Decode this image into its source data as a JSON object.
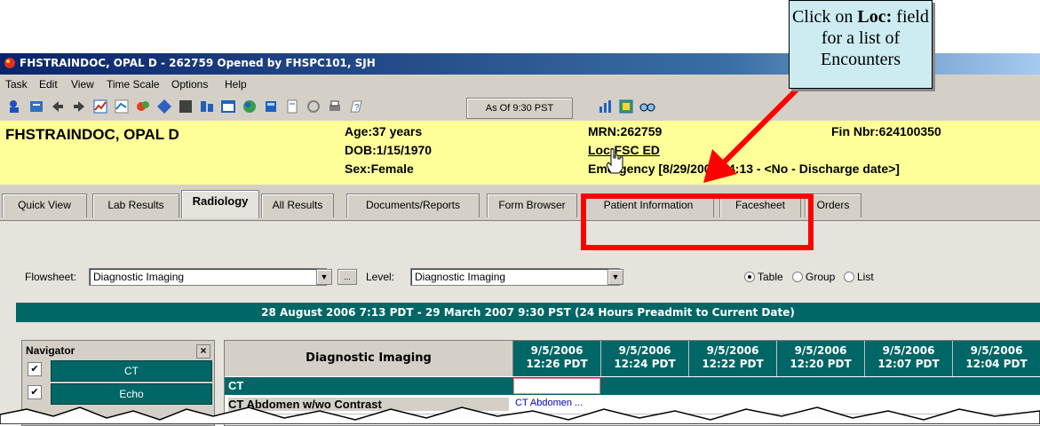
{
  "window": {
    "title": "FHSTRAINDOC, OPAL D - 262759 Opened by FHSPC101, SJH"
  },
  "menu": [
    "Task",
    "Edit",
    "View",
    "Time Scale",
    "Options",
    "Help"
  ],
  "toolbar": {
    "as_of": "As Of 9:30 PST"
  },
  "patient": {
    "name": "FHSTRAINDOC, OPAL D",
    "age": "Age:37 years",
    "dob": "DOB:1/15/1970",
    "sex": "Sex:Female",
    "mrn": "MRN:262759",
    "loc": "Loc:FSC ED",
    "encounter": "Emergency [8/29/2006 14:13 - <No - Discharge date>]",
    "fin": "Fin Nbr:624100350"
  },
  "tabs": [
    "Quick View",
    "Lab Results",
    "Radiology",
    "All Results",
    "Documents/Reports",
    "Form Browser",
    "Patient Information",
    "Facesheet",
    "Orders"
  ],
  "filters": {
    "flowsheet_label": "Flowsheet:",
    "flowsheet_value": "Diagnostic Imaging",
    "ellipsis": "...",
    "level_label": "Level:",
    "level_value": "Diagnostic Imaging",
    "view_options": [
      "Table",
      "Group",
      "List"
    ],
    "selected_view": "Table"
  },
  "date_range": "28 August 2006 7:13 PDT - 29 March 2007 9:30 PST (24 Hours Preadmit to Current Date)",
  "navigator": {
    "title": "Navigator",
    "items": [
      "CT",
      "Echo"
    ]
  },
  "grid": {
    "header": "Diagnostic Imaging",
    "columns": [
      {
        "date": "9/5/2006",
        "time": "12:26 PDT"
      },
      {
        "date": "9/5/2006",
        "time": "12:24 PDT"
      },
      {
        "date": "9/5/2006",
        "time": "12:22 PDT"
      },
      {
        "date": "9/5/2006",
        "time": "12:20 PDT"
      },
      {
        "date": "9/5/2006",
        "time": "12:07 PDT"
      },
      {
        "date": "9/5/2006",
        "time": "12:04 PDT"
      }
    ],
    "rows": [
      {
        "label": "CT",
        "cell": ""
      },
      {
        "label": "CT Abdomen w/wo Contrast",
        "cell": "CT Abdomen ..."
      }
    ]
  },
  "callout": {
    "before": "Click on ",
    "bold": "Loc:",
    "after": " field for a list of Encounters"
  },
  "colors": {
    "teal": "#006666",
    "banner": "#ffff99",
    "highlight": "#ff0000",
    "callout_bg": "#ccecf2"
  }
}
